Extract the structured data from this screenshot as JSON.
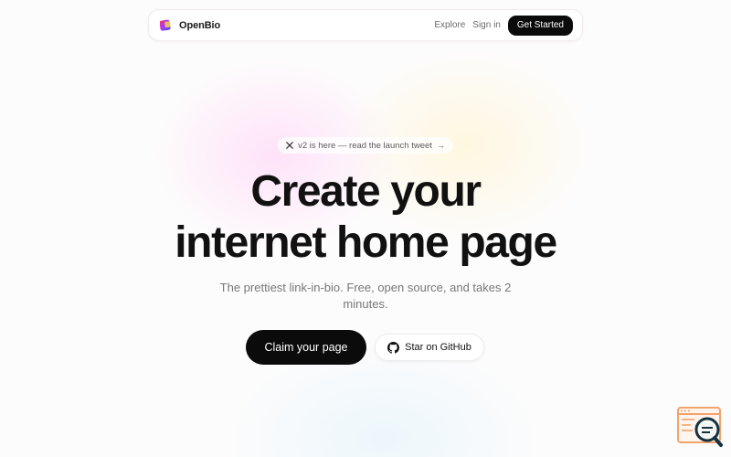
{
  "nav": {
    "brand": "OpenBio",
    "links": [
      "Explore",
      "Sign in"
    ],
    "cta": "Get Started"
  },
  "announcement": {
    "text": "v2 is here — read the launch tweet",
    "arrow": "→",
    "icon": "x-logo-icon"
  },
  "hero": {
    "title_line1": "Create your",
    "title_line2": "internet home page",
    "subtitle": "The prettiest link-in-bio. Free, open source, and takes 2 minutes.",
    "primary_cta": "Claim your page",
    "secondary_cta": "Star on GitHub",
    "secondary_icon": "github-icon"
  },
  "widget": {
    "icon": "search-browser-icon",
    "colors": {
      "frame": "#f2a36b",
      "magnifier": "#16333f",
      "lens": "#f4f7f6"
    }
  },
  "colors": {
    "primary": "#0b0b0b",
    "text_muted": "#777777",
    "logo_left": "#ff2f68",
    "logo_right": "#2f4bff"
  }
}
